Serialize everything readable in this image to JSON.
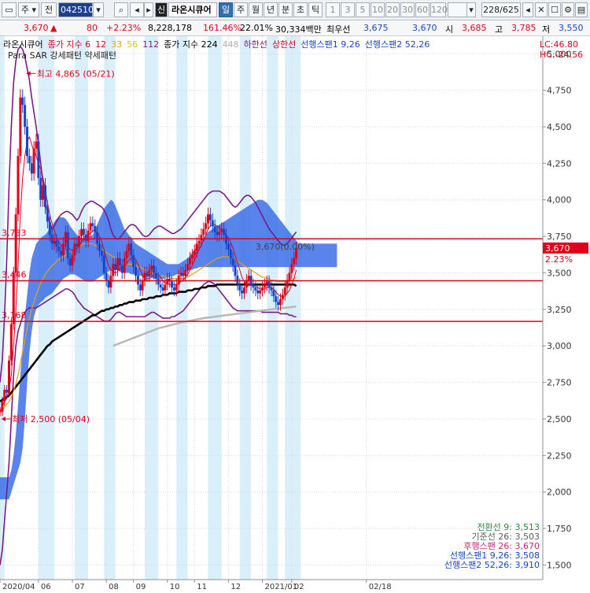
{
  "toolbar": {
    "market_label": "주",
    "prev_label": "전",
    "code": "042510",
    "stock_name": "라온시큐어",
    "badge": "신",
    "periods": [
      "일",
      "주",
      "월",
      "년",
      "분",
      "초",
      "틱"
    ],
    "active_period": "일",
    "intervals": [
      "1",
      "3",
      "5",
      "10",
      "20",
      "30",
      "60",
      "120"
    ],
    "count": "228/625"
  },
  "quote": {
    "price": "3,670",
    "change": "80",
    "change_pct": "+2.23%",
    "volume": "8,228,178",
    "volume_ratio": "161.46%",
    "turnover": "22.01%",
    "amount": "30,334백만",
    "best_label": "최우선",
    "best_ask": "3,675",
    "best_bid": "3,670",
    "open_label": "시",
    "open": "3,685",
    "high_label": "고",
    "high": "3,785",
    "low_label": "저",
    "low": "3,550"
  },
  "legend": {
    "line1": [
      {
        "text": "라온시큐어",
        "color": "#000000"
      },
      {
        "text": "종가 지수 6",
        "color": "#e0001a"
      },
      {
        "text": "12",
        "color": "#e0001a"
      },
      {
        "text": "33",
        "color": "#f0a000"
      },
      {
        "text": "56",
        "color": "#d8c800"
      },
      {
        "text": "112",
        "color": "#7a1b8a"
      },
      {
        "text": "종가 지수 224",
        "color": "#000000"
      },
      {
        "text": "448",
        "color": "#b0b0b0"
      },
      {
        "text": "하한선",
        "color": "#7a1b8a"
      },
      {
        "text": "상한선",
        "color": "#e0001a"
      },
      {
        "text": "선행스팬1 9,26",
        "color": "#1846c8"
      },
      {
        "text": "선행스팬2 52,26",
        "color": "#1846c8"
      }
    ],
    "line2": "Para SAR 강세패턴  약세패턴",
    "lc": "LC:46.80",
    "hc": "HC:-24.56"
  },
  "ichimoku": {
    "lines": [
      {
        "label": "전환선 9: 3,513",
        "color": "#2a8a3a"
      },
      {
        "label": "기준선 26: 3,503",
        "color": "#5a5a5a"
      },
      {
        "label": "후행스팬 26: 3,670",
        "color": "#c8286e"
      },
      {
        "label": "선행스팬1 9,26: 3,508",
        "color": "#1846c8"
      },
      {
        "label": "선행스팬2 52,26: 3,910",
        "color": "#1846c8"
      }
    ]
  },
  "price_tag": {
    "value": "3,670",
    "pct": "2.23%"
  },
  "chart_data": {
    "type": "line",
    "y_axis_side": "right",
    "ylim": [
      1400,
      5120
    ],
    "y_ticks": [
      1500,
      1750,
      2000,
      2250,
      2500,
      2750,
      3000,
      3250,
      3500,
      3750,
      4000,
      4250,
      4500,
      4750,
      5000
    ],
    "y_tick_labels": [
      "1,500",
      "1,750",
      "2,000",
      "2,250",
      "2,500",
      "2,750",
      "3,000",
      "3,250",
      "3,500",
      "3,750",
      "4,000",
      "4,250",
      "4,500",
      "4,750",
      "5,000"
    ],
    "x_range": [
      0,
      240
    ],
    "x_ticks": [
      {
        "x": 0,
        "label": "2020/04"
      },
      {
        "x": 17,
        "label": "06"
      },
      {
        "x": 32,
        "label": "07"
      },
      {
        "x": 47,
        "label": "08"
      },
      {
        "x": 59,
        "label": "09"
      },
      {
        "x": 74,
        "label": "10"
      },
      {
        "x": 86,
        "label": "11"
      },
      {
        "x": 101,
        "label": "12"
      },
      {
        "x": 116,
        "label": "2021/01"
      },
      {
        "x": 129,
        "label": "02"
      },
      {
        "x": 162,
        "label": "02/18"
      }
    ],
    "h_lines": [
      {
        "value": 3733,
        "label": "3,733"
      },
      {
        "value": 3446,
        "label": "3,446"
      },
      {
        "value": 3168,
        "label": "3,168"
      }
    ],
    "annotations": [
      {
        "text": "최고 4,865 (05/21)",
        "x": 11,
        "value": 4865
      },
      {
        "text": "최저 2,500 (05/04)",
        "x": 0,
        "value": 2500
      },
      {
        "text": "3,670(0.00%)",
        "x": 113,
        "value": 3680
      }
    ],
    "close": [
      2550,
      2620,
      2700,
      2680,
      2900,
      3150,
      3500,
      3900,
      4300,
      4700,
      4650,
      4500,
      4300,
      4250,
      4180,
      4350,
      4400,
      4150,
      4000,
      4100,
      3950,
      3850,
      3760,
      3700,
      3720,
      3680,
      3650,
      3620,
      3700,
      3780,
      3600,
      3550,
      3620,
      3700,
      3680,
      3750,
      3800,
      3760,
      3720,
      3790,
      3840,
      3820,
      3780,
      3700,
      3650,
      3620,
      3500,
      3450,
      3400,
      3480,
      3560,
      3520,
      3600,
      3550,
      3500,
      3600,
      3650,
      3700,
      3620,
      3540,
      3480,
      3420,
      3380,
      3450,
      3500,
      3480,
      3520,
      3550,
      3500,
      3460,
      3420,
      3400,
      3380,
      3420,
      3460,
      3440,
      3400,
      3380,
      3420,
      3480,
      3500,
      3480,
      3520,
      3560,
      3600,
      3620,
      3650,
      3700,
      3720,
      3760,
      3800,
      3840,
      3900,
      3860,
      3820,
      3780,
      3760,
      3780,
      3800,
      3760,
      3700,
      3660,
      3600,
      3550,
      3480,
      3420,
      3380,
      3360,
      3400,
      3450,
      3480,
      3420,
      3400,
      3380,
      3360,
      3380,
      3400,
      3420,
      3440,
      3400,
      3380,
      3340,
      3300,
      3280,
      3320,
      3350,
      3400,
      3450,
      3500,
      3560,
      3600,
      3670
    ],
    "ma6": [
      2550,
      2580,
      2620,
      2640,
      2700,
      2800,
      3000,
      3250,
      3550,
      3900,
      4150,
      4300,
      4400,
      4430,
      4380,
      4330,
      4300,
      4250,
      4210,
      4150,
      4070,
      3980,
      3900,
      3840,
      3790,
      3740,
      3710,
      3690,
      3680,
      3690,
      3680,
      3660,
      3650,
      3660,
      3670,
      3680,
      3710,
      3740,
      3760,
      3760,
      3770,
      3790,
      3790,
      3780,
      3750,
      3710,
      3660,
      3600,
      3550,
      3520,
      3510,
      3500,
      3510,
      3530,
      3540,
      3550,
      3560,
      3590,
      3600,
      3610,
      3590,
      3560,
      3520,
      3480,
      3460,
      3460,
      3460,
      3470,
      3490,
      3490,
      3490,
      3470,
      3450,
      3430,
      3430,
      3420,
      3420,
      3420,
      3420,
      3430,
      3440,
      3450,
      3470,
      3490,
      3520,
      3550,
      3590,
      3620,
      3660,
      3690,
      3720,
      3760,
      3800,
      3820,
      3830,
      3830,
      3820,
      3810,
      3800,
      3780,
      3760,
      3740,
      3710,
      3670,
      3620,
      3570,
      3520,
      3470,
      3440,
      3420,
      3420,
      3420,
      3420,
      3410,
      3400,
      3390,
      3390,
      3390,
      3400,
      3400,
      3400,
      3390,
      3370,
      3350,
      3340,
      3340,
      3340,
      3360,
      3380,
      3420,
      3460,
      3520
    ],
    "ma33": [
      2550,
      2560,
      2580,
      2600,
      2620,
      2650,
      2690,
      2740,
      2800,
      2880,
      2960,
      3040,
      3120,
      3190,
      3250,
      3300,
      3350,
      3390,
      3430,
      3460,
      3490,
      3510,
      3530,
      3550,
      3560,
      3580,
      3590,
      3600,
      3610,
      3620,
      3630,
      3640,
      3650,
      3660,
      3670,
      3680,
      3690,
      3700,
      3700,
      3700,
      3700,
      3700,
      3690,
      3680,
      3670,
      3660,
      3650,
      3640,
      3630,
      3620,
      3610,
      3600,
      3590,
      3580,
      3570,
      3560,
      3560,
      3560,
      3560,
      3550,
      3550,
      3540,
      3540,
      3530,
      3520,
      3520,
      3510,
      3500,
      3500,
      3490,
      3490,
      3480,
      3480,
      3470,
      3470,
      3470,
      3460,
      3460,
      3460,
      3460,
      3460,
      3460,
      3470,
      3470,
      3480,
      3490,
      3500,
      3510,
      3520,
      3530,
      3540,
      3550,
      3560,
      3570,
      3580,
      3590,
      3600,
      3600,
      3610,
      3610,
      3610,
      3610,
      3600,
      3600,
      3590,
      3580,
      3570,
      3560,
      3550,
      3540,
      3530,
      3520,
      3510,
      3500,
      3490,
      3480,
      3470,
      3470,
      3460,
      3460,
      3450,
      3450,
      3440,
      3440,
      3440,
      3440,
      3440,
      3440,
      3450,
      3450,
      3460,
      3470
    ],
    "ma224": [
      2620,
      2630,
      2640,
      2650,
      2660,
      2680,
      2700,
      2720,
      2740,
      2760,
      2780,
      2800,
      2820,
      2840,
      2860,
      2880,
      2900,
      2920,
      2940,
      2960,
      2980,
      3000,
      3010,
      3030,
      3040,
      3050,
      3060,
      3070,
      3080,
      3090,
      3100,
      3110,
      3120,
      3130,
      3140,
      3150,
      3160,
      3170,
      3180,
      3190,
      3200,
      3210,
      3210,
      3220,
      3230,
      3240,
      3240,
      3250,
      3250,
      3260,
      3260,
      3270,
      3270,
      3280,
      3280,
      3290,
      3290,
      3300,
      3300,
      3300,
      3310,
      3310,
      3310,
      3320,
      3320,
      3320,
      3330,
      3330,
      3330,
      3340,
      3340,
      3340,
      3350,
      3350,
      3350,
      3360,
      3360,
      3360,
      3360,
      3370,
      3370,
      3370,
      3370,
      3380,
      3380,
      3380,
      3390,
      3390,
      3390,
      3400,
      3400,
      3400,
      3410,
      3410,
      3410,
      3410,
      3420,
      3420,
      3420,
      3420,
      3420,
      3420,
      3420,
      3420,
      3420,
      3420,
      3420,
      3420,
      3420,
      3420,
      3420,
      3420,
      3420,
      3420,
      3420,
      3420,
      3420,
      3420,
      3420,
      3420,
      3420,
      3420,
      3420,
      3420,
      3420,
      3420,
      3420,
      3420,
      3420,
      3420,
      3420,
      3410
    ],
    "ma448": [
      {
        "x": 50,
        "value": 3000
      },
      {
        "x": 60,
        "value": 3060
      },
      {
        "x": 70,
        "value": 3120
      },
      {
        "x": 80,
        "value": 3160
      },
      {
        "x": 90,
        "value": 3190
      },
      {
        "x": 100,
        "value": 3210
      },
      {
        "x": 110,
        "value": 3230
      },
      {
        "x": 120,
        "value": 3250
      },
      {
        "x": 131,
        "value": 3270
      }
    ],
    "upper_band": [
      2750,
      2900,
      3200,
      3600,
      4100,
      4500,
      4800,
      4950,
      5030,
      5050,
      5030,
      4980,
      4900,
      4820,
      4700,
      4600,
      4500,
      4380,
      4250,
      4120,
      4000,
      3900,
      3850,
      3800,
      3820,
      3850,
      3880,
      3900,
      3910,
      3920,
      3920,
      3910,
      3900,
      3880,
      3860,
      3880,
      3920,
      3950,
      3970,
      3980,
      3990,
      3990,
      3980,
      3970,
      3960,
      3950,
      3930,
      3900,
      3860,
      3800,
      3760,
      3740,
      3730,
      3740,
      3760,
      3780,
      3800,
      3820,
      3830,
      3830,
      3820,
      3800,
      3780,
      3760,
      3750,
      3750,
      3760,
      3780,
      3800,
      3810,
      3820,
      3820,
      3810,
      3800,
      3790,
      3780,
      3770,
      3770,
      3780,
      3790,
      3800,
      3820,
      3840,
      3860,
      3880,
      3900,
      3920,
      3940,
      3960,
      3980,
      4000,
      4020,
      4040,
      4050,
      4060,
      4060,
      4060,
      4060,
      4050,
      4040,
      4020,
      4000,
      3980,
      3960,
      3950,
      3960,
      3980,
      4000,
      4020,
      4030,
      4030,
      4020,
      4000,
      3980,
      3950,
      3920,
      3890,
      3860,
      3830,
      3800,
      3780,
      3760,
      3740,
      3720,
      3700,
      3690,
      3690,
      3700,
      3720,
      3740,
      3760,
      3780
    ],
    "lower_band": [
      1500,
      1600,
      1800,
      2000,
      2200,
      2500,
      2800,
      3000,
      3100,
      3150,
      3200,
      3230,
      3250,
      3260,
      3260,
      3260,
      3260,
      3270,
      3280,
      3290,
      3300,
      3310,
      3320,
      3330,
      3340,
      3350,
      3360,
      3370,
      3380,
      3390,
      3390,
      3380,
      3370,
      3350,
      3320,
      3300,
      3280,
      3260,
      3250,
      3240,
      3230,
      3220,
      3210,
      3200,
      3190,
      3180,
      3170,
      3170,
      3170,
      3180,
      3200,
      3220,
      3230,
      3230,
      3220,
      3210,
      3200,
      3200,
      3200,
      3200,
      3200,
      3200,
      3200,
      3200,
      3200,
      3210,
      3220,
      3230,
      3230,
      3220,
      3210,
      3200,
      3190,
      3190,
      3190,
      3190,
      3200,
      3200,
      3210,
      3220,
      3230,
      3240,
      3260,
      3280,
      3300,
      3320,
      3340,
      3360,
      3380,
      3400,
      3420,
      3430,
      3440,
      3440,
      3430,
      3420,
      3400,
      3380,
      3360,
      3340,
      3320,
      3300,
      3280,
      3260,
      3250,
      3240,
      3240,
      3240,
      3240,
      3240,
      3240,
      3240,
      3240,
      3240,
      3240,
      3240,
      3230,
      3230,
      3230,
      3230,
      3230,
      3230,
      3230,
      3230,
      3220,
      3220,
      3220,
      3220,
      3210,
      3210,
      3200,
      3200
    ],
    "cloud_upper": [
      2100,
      2100,
      2100,
      2100,
      2100,
      2150,
      2250,
      2400,
      2600,
      2800,
      3000,
      3200,
      3350,
      3500,
      3600,
      3650,
      3700,
      3720,
      3740,
      3750,
      3760,
      3780,
      3800,
      3820,
      3850,
      3870,
      3880,
      3880,
      3880,
      3870,
      3850,
      3820,
      3800,
      3780,
      3760,
      3750,
      3740,
      3740,
      3740,
      3740,
      3750,
      3760,
      3790,
      3830,
      3870,
      3900,
      3940,
      3960,
      3980,
      4000,
      3990,
      3960,
      3920,
      3880,
      3840,
      3800,
      3780,
      3760,
      3740,
      3720,
      3700,
      3690,
      3680,
      3670,
      3660,
      3650,
      3640,
      3630,
      3620,
      3610,
      3600,
      3590,
      3580,
      3570,
      3560,
      3560,
      3560,
      3560,
      3560,
      3560,
      3570,
      3580,
      3590,
      3600,
      3620,
      3640,
      3660,
      3680,
      3700,
      3720,
      3740,
      3760,
      3780,
      3790,
      3800,
      3810,
      3820,
      3830,
      3840,
      3850,
      3860,
      3870,
      3880,
      3890,
      3900,
      3910,
      3920,
      3930,
      3940,
      3950,
      3960,
      3970,
      3980,
      3990,
      4000,
      4000,
      4000,
      3990,
      3980,
      3960,
      3940,
      3920,
      3900,
      3880,
      3860,
      3840,
      3820,
      3800,
      3780,
      3760,
      3740,
      3720,
      3700,
      3700,
      3700,
      3700,
      3700,
      3700,
      3700,
      3700,
      3700,
      3700,
      3700,
      3700,
      3700,
      3700,
      3700,
      3700,
      3700,
      3700
    ],
    "cloud_lower": [
      1950,
      1950,
      1950,
      1950,
      1950,
      2000,
      2050,
      2100,
      2150,
      2200,
      2300,
      2500,
      2750,
      2950,
      3100,
      3200,
      3250,
      3280,
      3300,
      3310,
      3330,
      3340,
      3350,
      3360,
      3380,
      3400,
      3420,
      3440,
      3460,
      3470,
      3480,
      3490,
      3490,
      3490,
      3480,
      3470,
      3460,
      3450,
      3440,
      3440,
      3440,
      3440,
      3450,
      3460,
      3470,
      3480,
      3490,
      3500,
      3510,
      3520,
      3520,
      3520,
      3520,
      3510,
      3510,
      3500,
      3500,
      3500,
      3490,
      3490,
      3490,
      3480,
      3480,
      3480,
      3470,
      3470,
      3470,
      3470,
      3460,
      3460,
      3460,
      3460,
      3460,
      3460,
      3470,
      3470,
      3480,
      3480,
      3490,
      3490,
      3500,
      3500,
      3510,
      3510,
      3520,
      3520,
      3530,
      3530,
      3540,
      3540,
      3540,
      3540,
      3540,
      3540,
      3540,
      3540,
      3540,
      3540,
      3540,
      3540,
      3540,
      3540,
      3540,
      3540,
      3540,
      3540,
      3540,
      3540,
      3540,
      3540,
      3540,
      3540,
      3540,
      3540,
      3540,
      3540,
      3540,
      3540,
      3540,
      3540,
      3540,
      3540,
      3540,
      3540,
      3540,
      3540,
      3540,
      3540,
      3540,
      3540,
      3540,
      3540,
      3540,
      3540,
      3540,
      3540,
      3540,
      3540,
      3540,
      3540,
      3540,
      3540,
      3540,
      3540,
      3540,
      3540,
      3540,
      3540,
      3540,
      3540
    ],
    "highlight_bands": [
      [
        0,
        2
      ],
      [
        17,
        24
      ],
      [
        33,
        39
      ],
      [
        46,
        51
      ],
      [
        64,
        70
      ],
      [
        78,
        83
      ],
      [
        92,
        98
      ],
      [
        106,
        111
      ],
      [
        118,
        123
      ],
      [
        126,
        133
      ]
    ],
    "colors": {
      "up": "#e0001a",
      "down": "#1846c8",
      "cloud": "#3b6fe8",
      "band": "#7a1b8a",
      "ma224": "#000000",
      "ma448": "#b8b8b8",
      "ma33": "#f0a000",
      "ma6": "#e0001a",
      "highlight": "#d9effa"
    }
  }
}
